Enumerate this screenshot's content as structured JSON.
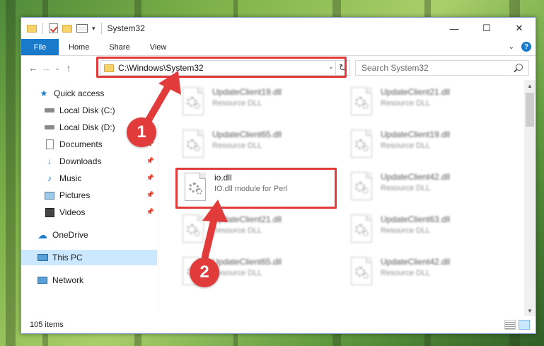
{
  "window": {
    "title": "System32",
    "controls": {
      "minimize": "—",
      "maximize": "☐",
      "close": "✕"
    }
  },
  "ribbon": {
    "file": "File",
    "tabs": [
      "Home",
      "Share",
      "View"
    ],
    "help": "?"
  },
  "nav": {
    "back": "←",
    "forward": "→",
    "recent": "⌄",
    "up": "↑",
    "address": "C:\\Windows\\System32",
    "search_placeholder": "Search System32"
  },
  "sidebar": {
    "items": [
      {
        "label": "Quick access",
        "icon": "star-icon",
        "pinned": false
      },
      {
        "label": "Local Disk (C:)",
        "icon": "drive-icon",
        "pinned": false
      },
      {
        "label": "Local Disk (D:)",
        "icon": "drive-icon",
        "pinned": false
      },
      {
        "label": "Documents",
        "icon": "documents-icon",
        "pinned": true
      },
      {
        "label": "Downloads",
        "icon": "download-icon",
        "pinned": true
      },
      {
        "label": "Music",
        "icon": "music-icon",
        "pinned": true
      },
      {
        "label": "Pictures",
        "icon": "pictures-icon",
        "pinned": true
      },
      {
        "label": "Videos",
        "icon": "videos-icon",
        "pinned": true
      },
      {
        "label": "OneDrive",
        "icon": "cloud-icon",
        "pinned": false
      },
      {
        "label": "This PC",
        "icon": "computer-icon",
        "pinned": false,
        "selected": true
      },
      {
        "label": "Network",
        "icon": "network-icon",
        "pinned": false
      }
    ]
  },
  "files": [
    {
      "name": "UpdateClient19.dll",
      "desc": "Resource DLL",
      "blurred": true
    },
    {
      "name": "UpdateClient21.dll",
      "desc": "Resource DLL",
      "blurred": true
    },
    {
      "name": "UpdateClient65.dll",
      "desc": "Resource DLL",
      "blurred": true
    },
    {
      "name": "UpdateClient19.dll",
      "desc": "Resource DLL",
      "blurred": true
    },
    {
      "name": "io.dll",
      "desc": "IO.dll module for Perl",
      "blurred": false,
      "highlighted": true
    },
    {
      "name": "UpdateClient42.dll",
      "desc": "Resource DLL",
      "blurred": true
    },
    {
      "name": "UpdateClient21.dll",
      "desc": "Resource DLL",
      "blurred": true
    },
    {
      "name": "UpdateClient63.dll",
      "desc": "Resource DLL",
      "blurred": true
    },
    {
      "name": "UpdateClient65.dll",
      "desc": "Resource DLL",
      "blurred": true
    },
    {
      "name": "UpdateClient42.dll",
      "desc": "Resource DLL",
      "blurred": true
    }
  ],
  "status": {
    "item_count": "105 items"
  },
  "annotations": {
    "step1": "1",
    "step2": "2",
    "color": "#e23b3b"
  }
}
